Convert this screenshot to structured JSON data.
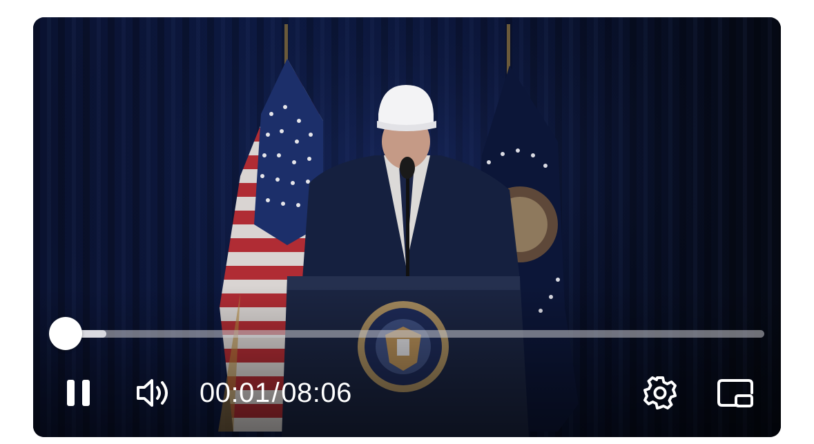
{
  "player": {
    "time": {
      "current": "00:01",
      "separator": "/",
      "duration": "08:06"
    },
    "progress": {
      "played_fraction": 0.0021,
      "buffered_fraction": 0.06
    },
    "icons": {
      "pause": "pause-icon",
      "volume": "volume-icon",
      "settings": "gear-icon",
      "pip": "picture-in-picture-icon"
    },
    "colors": {
      "controls": "#ffffff",
      "track": "#c8c8cd",
      "background": "#070b18"
    }
  }
}
